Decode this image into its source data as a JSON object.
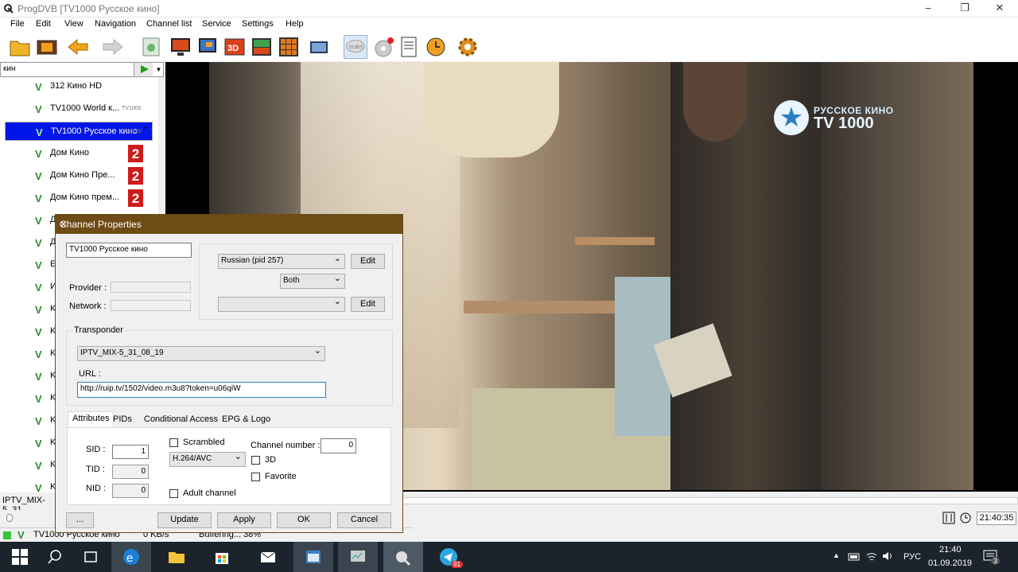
{
  "window": {
    "title": "ProgDVB [TV1000 Русское кино]",
    "minimize": "–",
    "restore": "❐",
    "close": "✕"
  },
  "menu": [
    "File",
    "Edit",
    "View",
    "Navigation",
    "Channel list",
    "Service",
    "Settings",
    "Help"
  ],
  "toolbar_icons": [
    "open-folder-icon",
    "film-icon",
    "back-arrow-icon",
    "forward-arrow-icon",
    "schedule-icon",
    "monitor-icon",
    "monitor-small-icon",
    "3d-icon",
    "picture-icon",
    "grid-icon",
    "screen-icon",
    "subs-icon",
    "record-disc-icon",
    "notes-icon",
    "clock-icon",
    "gear-icon"
  ],
  "toolbar_labels": {
    "3d": "3D",
    "subs": "SUBS"
  },
  "search": {
    "value": "кин"
  },
  "channels": [
    {
      "name": "312 Кино HD",
      "badge": ""
    },
    {
      "name": "TV1000 World к...",
      "badge": "tv"
    },
    {
      "name": "TV1000 Русское кино",
      "badge": "tv",
      "selected": true
    },
    {
      "name": "Дом Кино",
      "badge": "2"
    },
    {
      "name": "Дом Кино Пре...",
      "badge": "2"
    },
    {
      "name": "Дом Кино прем...",
      "badge": "2"
    },
    {
      "name": "Д",
      "badge": ""
    },
    {
      "name": "Д",
      "badge": ""
    },
    {
      "name": "E",
      "badge": ""
    },
    {
      "name": "И",
      "badge": ""
    },
    {
      "name": "K",
      "badge": ""
    },
    {
      "name": "K",
      "badge": ""
    },
    {
      "name": "K",
      "badge": ""
    },
    {
      "name": "K",
      "badge": ""
    },
    {
      "name": "K",
      "badge": ""
    },
    {
      "name": "K",
      "badge": ""
    },
    {
      "name": "K",
      "badge": ""
    },
    {
      "name": "K",
      "badge": ""
    },
    {
      "name": "K",
      "badge": ""
    }
  ],
  "channel_badge_tv_text": "TV1000",
  "channel_badge_2_text": "2",
  "video": {
    "logo_line1": "РУССКОЕ КИНО",
    "logo_line2": "TV 1000"
  },
  "status": {
    "transponder": "IPTV_MIX-5_31",
    "channel": "TV1000 Русское кино",
    "rate": "0 KB/s",
    "buffering": "Buffering... 38%",
    "time": "21:40:35"
  },
  "dialog": {
    "title": "Channel Properties",
    "name": "TV1000 Русское кино",
    "provider_label": "Provider :",
    "network_label": "Network :",
    "audio": "Russian (pid 257)",
    "audio_mode": "Both",
    "subtitle": "",
    "edit": "Edit",
    "transponder_group": "Transponder",
    "transponder": "IPTV_MIX-5_31_08_19",
    "url_label": "URL :",
    "url": "http://ruip.tv/1502/video.m3u8?token=u06qiW",
    "tabs": [
      "Attributes",
      "PIDs",
      "Conditional Access",
      "EPG & Logo"
    ],
    "sid_label": "SID :",
    "sid": "1",
    "tid_label": "TID :",
    "tid": "0",
    "nid_label": "NID :",
    "nid": "0",
    "scrambled": "Scrambled",
    "codec": "H.264/AVC",
    "adult": "Adult channel",
    "chnum_label": "Channel number :",
    "chnum": "0",
    "three_d": "3D",
    "favorite": "Favorite",
    "btn_more": "...",
    "btn_update": "Update",
    "btn_apply": "Apply",
    "btn_ok": "OK",
    "btn_cancel": "Cancel"
  },
  "taskbar": {
    "time": "21:40",
    "date": "01.09.2019",
    "lang": "РУС",
    "notif_count": "3",
    "telegram_badge": "91"
  }
}
